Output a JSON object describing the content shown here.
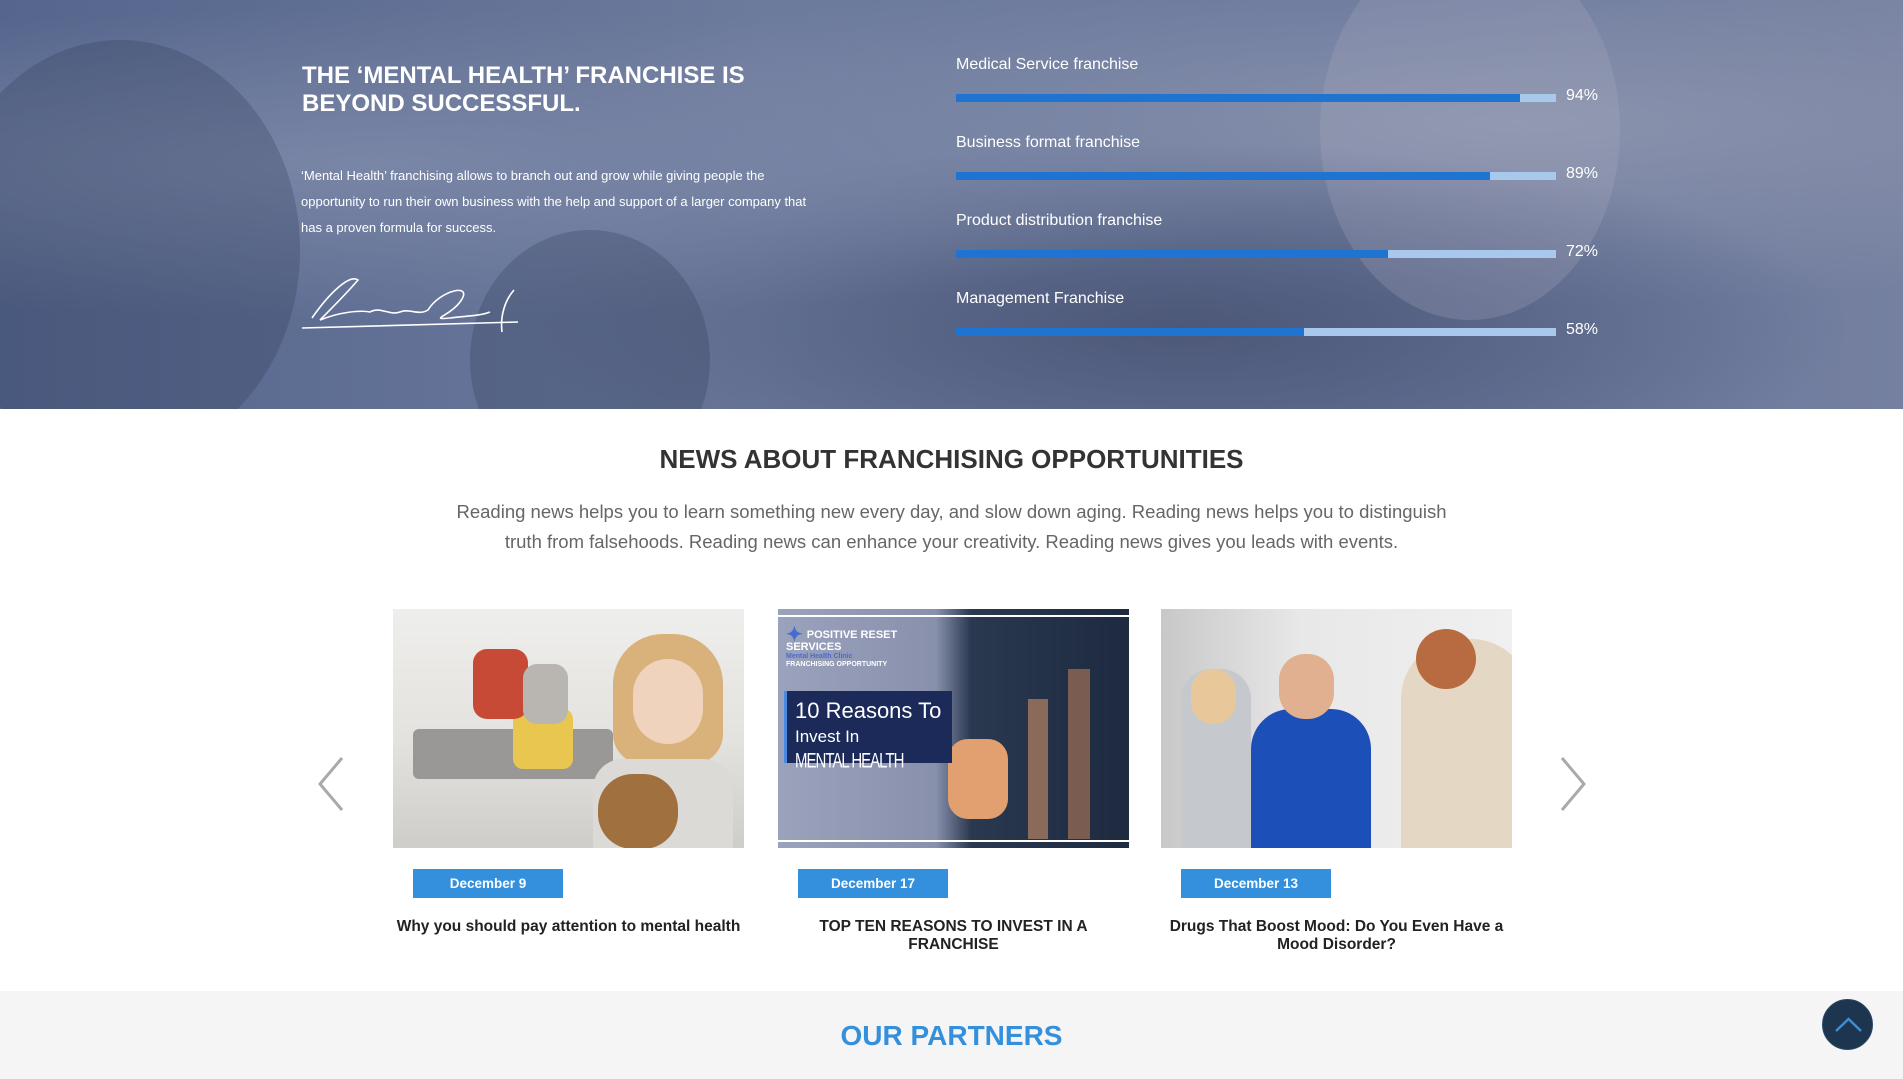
{
  "hero": {
    "title": "THE ‘MENTAL HEALTH’ FRANCHISE IS BEYOND SUCCESSFUL.",
    "text": "‘Mental Health’ franchising allows to branch out and grow while giving people the opportunity to run their own business with the help and support of a larger company that has a proven formula for success.",
    "skills": [
      {
        "label": "Medical Service franchise",
        "value": 94,
        "display": "94%"
      },
      {
        "label": "Business format franchise",
        "value": 89,
        "display": "89%"
      },
      {
        "label": "Product distribution franchise",
        "value": 72,
        "display": "72%"
      },
      {
        "label": "Management Franchise",
        "value": 58,
        "display": "58%"
      }
    ],
    "colors": {
      "bar_fill": "#1e74d0",
      "bar_track": "#a8c8ec"
    }
  },
  "news": {
    "title": "NEWS ABOUT FRANCHISING OPPORTUNITIES",
    "text": "Reading news helps you to learn something new every day, and slow down aging. Reading news helps you to distinguish truth from falsehoods. Reading news can enhance your creativity. Reading news gives you leads with events.",
    "cards": [
      {
        "date": "December 9",
        "title": "Why you should pay attention to mental health"
      },
      {
        "date": "December 17",
        "title": "TOP TEN REASONS TO INVEST IN A FRANCHISE",
        "image_text": {
          "brand": "POSITIVE RESET SERVICES",
          "sub1": "Mental Health Clinic",
          "sub2": "FRANCHISING OPPORTUNITY",
          "line1": "10 Reasons To",
          "line2a": "Invest In ",
          "line2b": "MENTAL HEALTH"
        }
      },
      {
        "date": "December 13",
        "title": "Drugs That Boost Mood: Do You Even Have a Mood Disorder?"
      }
    ],
    "accent": "#3490dc"
  },
  "partners": {
    "title": "OUR PARTNERS"
  }
}
